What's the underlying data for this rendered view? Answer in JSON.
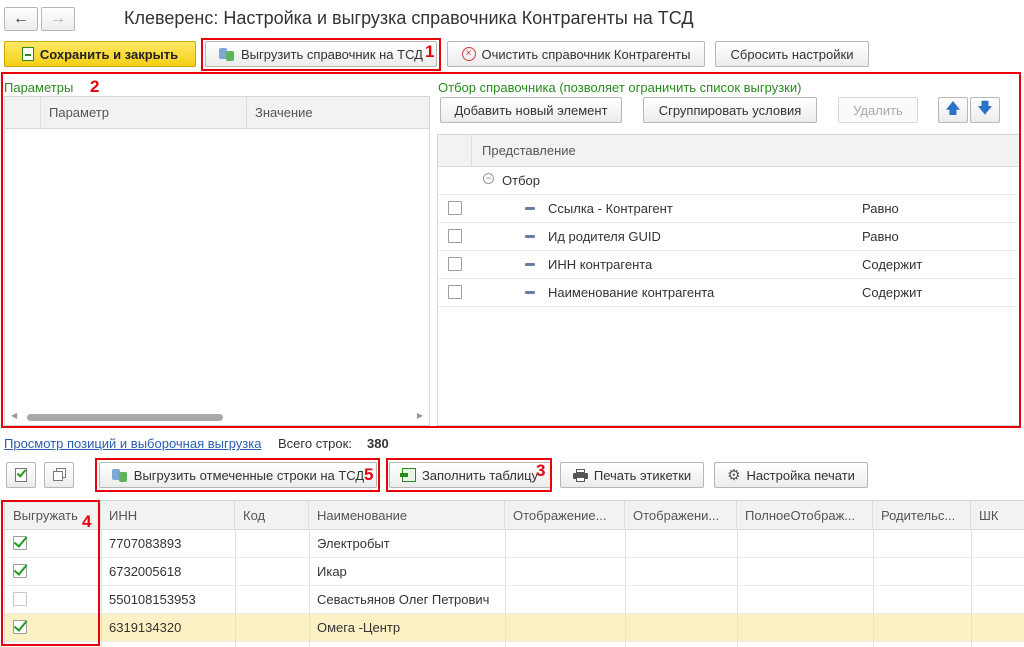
{
  "nav": {
    "back_glyph": "←",
    "forward_glyph": "→"
  },
  "window": {
    "title": "Клеверенс: Настройка и выгрузка справочника Контрагенты на ТСД"
  },
  "toolbar": {
    "save_close": "Сохранить и закрыть",
    "upload_to_tsd": "Выгрузить справочник на ТСД",
    "clear_catalog": "Очистить справочник Контрагенты",
    "reset_settings": "Сбросить настройки"
  },
  "params": {
    "title": "Параметры",
    "columns": [
      "Параметр",
      "Значение"
    ]
  },
  "filter": {
    "title": "Отбор справочника (позволяет ограничить список выгрузки)",
    "add_button": "Добавить новый элемент",
    "group_button": "Сгруппировать условия",
    "delete_button": "Удалить",
    "column_header": "Представление",
    "root_label": "Отбор",
    "rows": [
      {
        "field": "Ссылка - Контрагент",
        "condition": "Равно"
      },
      {
        "field": "Ид родителя GUID",
        "condition": "Равно"
      },
      {
        "field": "ИНН контрагента",
        "condition": "Содержит"
      },
      {
        "field": "Наименование контрагента",
        "condition": "Содержит"
      }
    ]
  },
  "preview": {
    "link": "Просмотр позиций и выборочная выгрузка",
    "total_label": "Всего строк:",
    "total_value": "380"
  },
  "table_toolbar": {
    "upload_marked": "Выгрузить отмеченные строки на ТСД",
    "fill_table": "Заполнить таблицу",
    "print_labels": "Печать этикетки",
    "print_settings": "Настройка печати"
  },
  "table": {
    "columns": [
      "Выгружать",
      "ИНН",
      "Код",
      "Наименование",
      "Отображение...",
      "Отображени...",
      "ПолноеОтображ...",
      "Родительс...",
      "ШК"
    ],
    "rows": [
      {
        "checked": true,
        "inn": "7707083893",
        "code": "",
        "name": "Электробыт"
      },
      {
        "checked": true,
        "inn": "6732005618",
        "code": "",
        "name": "Икар"
      },
      {
        "checked": false,
        "inn": "550108153953",
        "code": "",
        "name": "Севастьянов Олег Петрович"
      },
      {
        "checked": true,
        "inn": "6319134320",
        "code": "",
        "name": "Омега -Центр"
      }
    ]
  },
  "annotations": [
    "1",
    "2",
    "3",
    "4",
    "5"
  ],
  "colors": {
    "annotation_red": "#e8000b",
    "link_green": "#2a8a1f",
    "save_yellow": "#f4cf15",
    "selected_row": "#fbf1c4"
  }
}
